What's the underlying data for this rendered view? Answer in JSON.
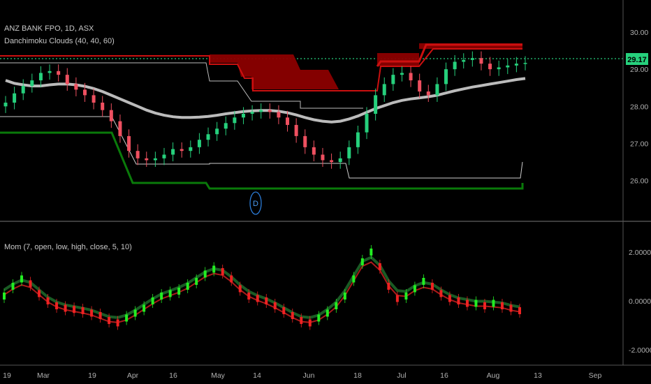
{
  "header": {
    "symbol": "ANZ BANK FPO, 1D, ASX",
    "indicator1": "Danchimoku Clouds (40, 40, 60)",
    "indicator2": "Mom (7, open, low, high, close, 5, 10)"
  },
  "price_badge": "29.17",
  "event_marker": "D",
  "colors": {
    "background": "#000000",
    "up": "#26d07c",
    "down": "#ef5060",
    "cloud": "#8b0000",
    "cloud_top": "#cc1010",
    "support": "#0a7a0a",
    "ma": "#cfcfcf",
    "mom_up": "#22ee22",
    "mom_down": "#ee2222"
  },
  "chart_data": [
    {
      "type": "candlestick",
      "title": "ANZ BANK FPO, 1D, ASX",
      "y_ticks": [
        "30.00",
        "29.00",
        "28.00",
        "27.00",
        "26.00"
      ],
      "x_ticks": [
        "19",
        "Mar",
        "19",
        "Apr",
        "16",
        "May",
        "14",
        "Jun",
        "18",
        "Jul",
        "16",
        "Aug",
        "13",
        "Sep"
      ],
      "ylim": [
        25.6,
        30.3
      ],
      "last_price": 29.17,
      "close_series": [
        28.1,
        28.35,
        28.55,
        28.7,
        28.9,
        28.95,
        28.85,
        28.6,
        28.45,
        28.3,
        28.1,
        27.9,
        27.6,
        27.2,
        26.8,
        26.6,
        26.55,
        26.6,
        26.7,
        26.85,
        26.8,
        26.9,
        27.1,
        27.25,
        27.4,
        27.55,
        27.7,
        27.8,
        27.85,
        27.9,
        27.85,
        27.7,
        27.5,
        27.2,
        26.9,
        26.7,
        26.55,
        26.5,
        26.6,
        26.9,
        27.3,
        27.8,
        28.3,
        28.6,
        28.85,
        28.9,
        28.7,
        28.4,
        28.3,
        28.6,
        29.0,
        29.2,
        29.25,
        29.3,
        29.15,
        29.0,
        29.05,
        29.1,
        29.15,
        29.17
      ],
      "ma_series": [
        28.7,
        28.62,
        28.58,
        28.55,
        28.55,
        28.58,
        28.6,
        28.6,
        28.58,
        28.54,
        28.48,
        28.4,
        28.3,
        28.2,
        28.1,
        28.0,
        27.9,
        27.82,
        27.76,
        27.72,
        27.7,
        27.7,
        27.71,
        27.73,
        27.76,
        27.8,
        27.83,
        27.86,
        27.88,
        27.89,
        27.89,
        27.87,
        27.83,
        27.77,
        27.7,
        27.64,
        27.6,
        27.58,
        27.6,
        27.66,
        27.74,
        27.84,
        27.94,
        28.02,
        28.1,
        28.16,
        28.2,
        28.23,
        28.26,
        28.3,
        28.36,
        28.42,
        28.47,
        28.52,
        28.56,
        28.6,
        28.64,
        28.68,
        28.72,
        28.75
      ]
    },
    {
      "type": "bar",
      "title": "Mom (7, open, low, high, close, 5, 10)",
      "y_ticks": [
        "2.0000",
        "0.0000",
        "-2.0000"
      ],
      "ylim": [
        -2.4,
        2.6
      ],
      "values": [
        0.2,
        0.6,
        0.9,
        0.7,
        0.3,
        0.0,
        -0.2,
        -0.3,
        -0.35,
        -0.4,
        -0.5,
        -0.6,
        -0.8,
        -0.9,
        -0.7,
        -0.5,
        -0.3,
        0.0,
        0.2,
        0.3,
        0.4,
        0.6,
        0.8,
        1.1,
        1.3,
        1.2,
        0.9,
        0.5,
        0.2,
        0.1,
        0.0,
        -0.2,
        -0.4,
        -0.6,
        -0.8,
        -0.9,
        -0.7,
        -0.5,
        -0.2,
        0.2,
        0.9,
        1.6,
        2.0,
        1.4,
        0.6,
        0.1,
        0.2,
        0.5,
        0.8,
        0.6,
        0.3,
        0.1,
        0.0,
        -0.1,
        -0.1,
        -0.2,
        -0.1,
        -0.2,
        -0.3,
        -0.4
      ]
    }
  ]
}
